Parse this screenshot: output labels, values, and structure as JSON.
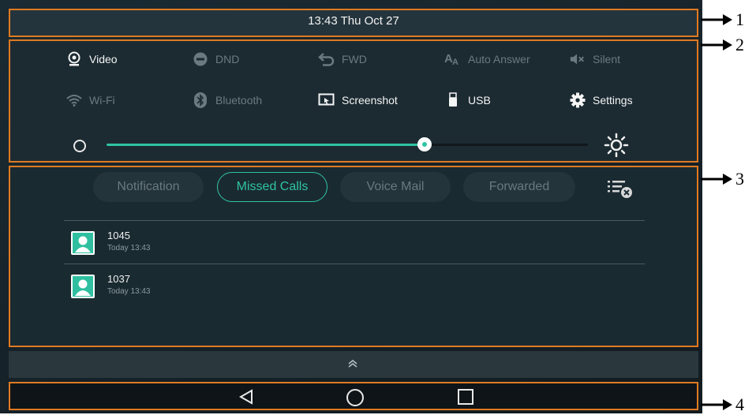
{
  "statusbar": {
    "datetime": "13:43 Thu Oct 27"
  },
  "quick_settings": {
    "row1": [
      {
        "label": "Video",
        "icon": "video-camera-icon",
        "state": "on"
      },
      {
        "label": "DND",
        "icon": "do-not-disturb-icon",
        "state": "off"
      },
      {
        "label": "FWD",
        "icon": "forward-arrow-icon",
        "state": "off"
      },
      {
        "label": "Auto Answer",
        "icon": "auto-answer-icon",
        "state": "off"
      },
      {
        "label": "Silent",
        "icon": "speaker-mute-icon",
        "state": "off"
      }
    ],
    "row2": [
      {
        "label": "Wi-Fi",
        "icon": "wifi-icon",
        "state": "off"
      },
      {
        "label": "Bluetooth",
        "icon": "bluetooth-icon",
        "state": "off"
      },
      {
        "label": "Screenshot",
        "icon": "screenshot-icon",
        "state": "on"
      },
      {
        "label": "USB",
        "icon": "usb-icon",
        "state": "on"
      },
      {
        "label": "Settings",
        "icon": "gear-icon",
        "state": "on"
      }
    ],
    "brightness_level": 0.66
  },
  "notifications": {
    "tabs": [
      {
        "label": "Notification",
        "active": false
      },
      {
        "label": "Missed Calls",
        "active": true
      },
      {
        "label": "Voice Mail",
        "active": false
      },
      {
        "label": "Forwarded",
        "active": false
      }
    ],
    "items": [
      {
        "number": "1045",
        "time": "Today 13:43"
      },
      {
        "number": "1037",
        "time": "Today 13:43"
      }
    ]
  },
  "callouts": [
    "1",
    "2",
    "3",
    "4"
  ],
  "colors": {
    "accent": "#2fc4a3",
    "outline": "#e07a22",
    "background": "#1a2a31"
  }
}
